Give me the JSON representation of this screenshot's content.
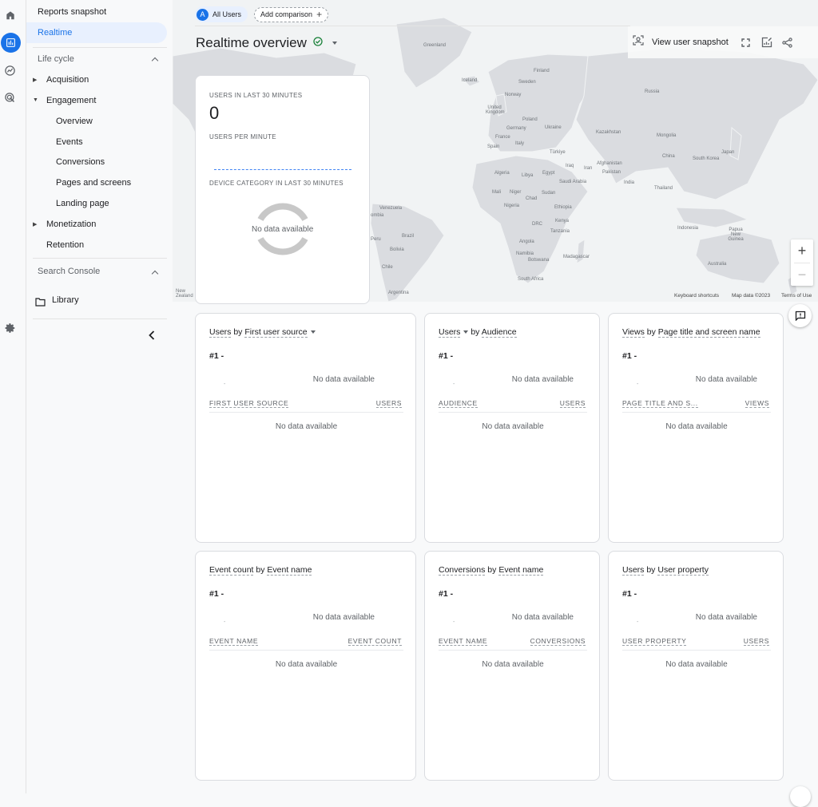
{
  "rail": {
    "icons": [
      "home-icon",
      "reports-icon",
      "explore-icon",
      "advertising-icon"
    ],
    "settings_icon": "gear-icon"
  },
  "sidebar": {
    "reports_snapshot": "Reports snapshot",
    "realtime": "Realtime",
    "lifecycle_label": "Life cycle",
    "acquisition": "Acquisition",
    "engagement": "Engagement",
    "engagement_items": [
      "Overview",
      "Events",
      "Conversions",
      "Pages and screens",
      "Landing page"
    ],
    "monetization": "Monetization",
    "retention": "Retention",
    "search_console_label": "Search Console",
    "library": "Library"
  },
  "header": {
    "segment_avatar": "A",
    "segment_label": "All Users",
    "add_comparison": "Add comparison",
    "title": "Realtime overview",
    "view_user_snapshot": "View user snapshot"
  },
  "map": {
    "countries": {
      "greenland": "Greenland",
      "iceland": "Iceland",
      "finland": "Finland",
      "sweden": "Sweden",
      "norway": "Norway",
      "uk": "United Kingdom",
      "poland": "Poland",
      "germany": "Germany",
      "ukraine": "Ukraine",
      "france": "France",
      "italy": "Italy",
      "spain": "Spain",
      "turkiye": "Türkiye",
      "iraq": "Iraq",
      "iran": "Iran",
      "russia": "Russia",
      "kazakhstan": "Kazakhstan",
      "mongolia": "Mongolia",
      "china": "China",
      "south_korea": "South Korea",
      "japan": "Japan",
      "afghanistan": "Afghanistan",
      "pakistan": "Pakistan",
      "india": "India",
      "thailand": "Thailand",
      "indonesia": "Indonesia",
      "png": "Papua New Guinea",
      "australia": "Australia",
      "new_zealand": "New Zealand",
      "algeria": "Algeria",
      "libya": "Libya",
      "egypt": "Egypt",
      "saudi": "Saudi Arabia",
      "mali": "Mali",
      "niger": "Niger",
      "chad": "Chad",
      "sudan": "Sudan",
      "nigeria": "Nigeria",
      "ethiopia": "Ethiopia",
      "drc": "DRC",
      "kenya": "Kenya",
      "tanzania": "Tanzania",
      "angola": "Angola",
      "namibia": "Namibia",
      "botswana": "Botswana",
      "madagascar": "Madagascar",
      "south_africa": "South Africa",
      "venezuela": "Venezuela",
      "colombia": "ombia",
      "peru": "Peru",
      "brazil": "Brazil",
      "bolivia": "Bolivia",
      "chile": "Chile",
      "argentina": "Argentina"
    },
    "keyboard_shortcuts": "Keyboard shortcuts",
    "map_data": "Map data ©2023",
    "terms": "Terms of Use",
    "zoom_in": "+",
    "zoom_out": "−"
  },
  "kpi_card": {
    "users_label": "USERS IN LAST 30 MINUTES",
    "users_value": "0",
    "per_minute_label": "USERS PER MINUTE",
    "device_label": "DEVICE CATEGORY IN LAST 30 MINUTES",
    "no_data": "No data available"
  },
  "cards": [
    {
      "title_a": "Users",
      "title_mid": " by ",
      "title_b": "First user source",
      "rank": "#1  -",
      "tick": "-",
      "no_data_top": "No data available",
      "col1": "FIRST USER SOURCE",
      "col2": "USERS",
      "no_data_table": "No data available"
    },
    {
      "title_a": "Users",
      "title_mid": " by ",
      "title_b": "Audience",
      "rank": "#1  -",
      "tick": "-",
      "no_data_top": "No data available",
      "col1": "AUDIENCE",
      "col2": "USERS",
      "no_data_table": "No data available"
    },
    {
      "title_a": "Views",
      "title_mid": " by ",
      "title_b": "Page title and screen name",
      "rank": "#1  -",
      "tick": "-",
      "no_data_top": "No data available",
      "col1": "PAGE TITLE AND S...",
      "col2": "VIEWS",
      "no_data_table": "No data available"
    },
    {
      "title_a": "Event count",
      "title_mid": " by ",
      "title_b": "Event name",
      "rank": "#1  -",
      "tick": "-",
      "no_data_top": "No data available",
      "col1": "EVENT NAME",
      "col2": "EVENT COUNT",
      "no_data_table": "No data available"
    },
    {
      "title_a": "Conversions",
      "title_mid": " by ",
      "title_b": "Event name",
      "rank": "#1  -",
      "tick": "-",
      "no_data_top": "No data available",
      "col1": "EVENT NAME",
      "col2": "CONVERSIONS",
      "no_data_table": "No data available"
    },
    {
      "title_a": "Users",
      "title_mid": " by ",
      "title_b": "User property",
      "rank": "#1  -",
      "tick": "-",
      "no_data_top": "No data available",
      "col1": "USER PROPERTY",
      "col2": "USERS",
      "no_data_table": "No data available"
    }
  ],
  "colors": {
    "accent": "#1a73e8",
    "active_bg": "#e8f0fe",
    "success": "#188038",
    "land": "#dadce0"
  }
}
